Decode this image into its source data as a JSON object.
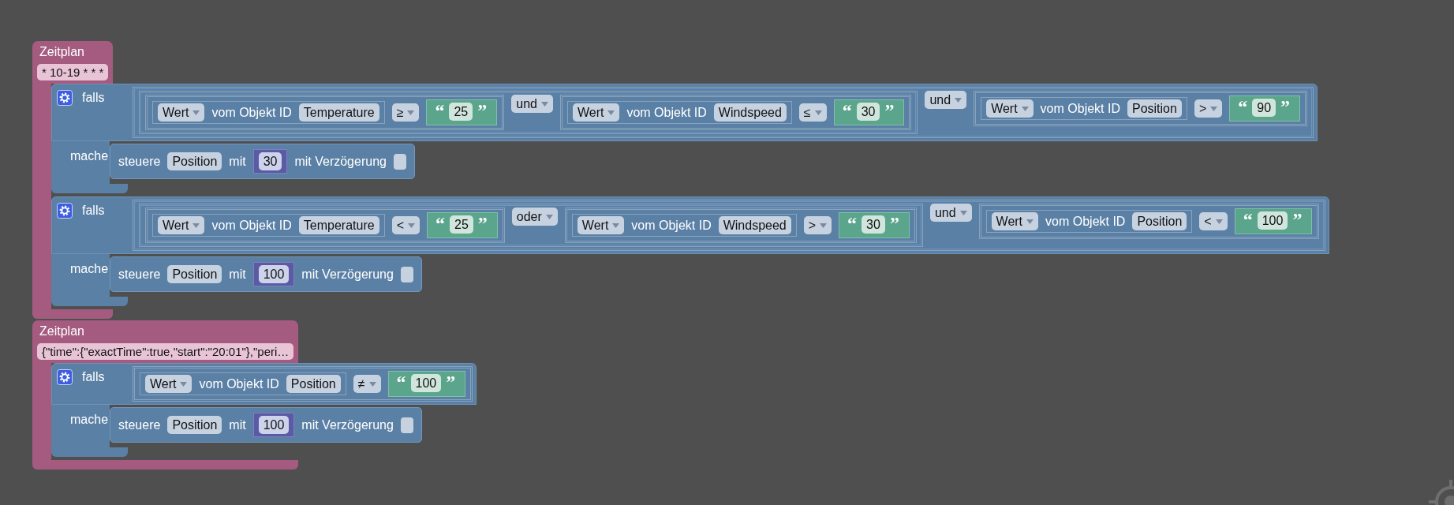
{
  "schedules": [
    {
      "title": "Zeitplan",
      "schedule": "* 10-19 * * *",
      "statements": [
        {
          "kind": "if",
          "if_label": "falls",
          "do_label": "mache",
          "condition": {
            "kind": "logic",
            "operator": "und",
            "left": {
              "kind": "logic",
              "operator": "und",
              "left": {
                "kind": "compare",
                "operator": "≥",
                "left": {
                  "kind": "get",
                  "mode": "Wert",
                  "label": "vom Objekt ID",
                  "object": "Temperature"
                },
                "right": {
                  "kind": "text",
                  "open_quote": "“",
                  "value": "25",
                  "close_quote": "”"
                }
              },
              "right": {
                "kind": "compare",
                "operator": "≤",
                "left": {
                  "kind": "get",
                  "mode": "Wert",
                  "label": "vom Objekt ID",
                  "object": "Windspeed"
                },
                "right": {
                  "kind": "text",
                  "open_quote": "“",
                  "value": "30",
                  "close_quote": "”"
                }
              }
            },
            "right": {
              "kind": "compare",
              "operator": ">",
              "left": {
                "kind": "get",
                "mode": "Wert",
                "label": "vom Objekt ID",
                "object": "Position"
              },
              "right": {
                "kind": "text",
                "open_quote": "“",
                "value": "90",
                "close_quote": "”"
              }
            }
          },
          "action": {
            "kind": "control",
            "verb": "steuere",
            "object": "Position",
            "with_label": "mit",
            "value": "30",
            "delay_label": "mit Verzögerung",
            "delay": false
          }
        },
        {
          "kind": "if",
          "if_label": "falls",
          "do_label": "mache",
          "condition": {
            "kind": "logic",
            "operator": "und",
            "left": {
              "kind": "logic",
              "operator": "oder",
              "left": {
                "kind": "compare",
                "operator": "<",
                "left": {
                  "kind": "get",
                  "mode": "Wert",
                  "label": "vom Objekt ID",
                  "object": "Temperature"
                },
                "right": {
                  "kind": "text",
                  "open_quote": "“",
                  "value": "25",
                  "close_quote": "”"
                }
              },
              "right": {
                "kind": "compare",
                "operator": ">",
                "left": {
                  "kind": "get",
                  "mode": "Wert",
                  "label": "vom Objekt ID",
                  "object": "Windspeed"
                },
                "right": {
                  "kind": "text",
                  "open_quote": "“",
                  "value": "30",
                  "close_quote": "”"
                }
              }
            },
            "right": {
              "kind": "compare",
              "operator": "<",
              "left": {
                "kind": "get",
                "mode": "Wert",
                "label": "vom Objekt ID",
                "object": "Position"
              },
              "right": {
                "kind": "text",
                "open_quote": "“",
                "value": "100",
                "close_quote": "”"
              }
            }
          },
          "action": {
            "kind": "control",
            "verb": "steuere",
            "object": "Position",
            "with_label": "mit",
            "value": "100",
            "delay_label": "mit Verzögerung",
            "delay": false
          }
        }
      ]
    },
    {
      "title": "Zeitplan",
      "schedule": "{\"time\":{\"exactTime\":true,\"start\":\"20:01\"},\"peri…",
      "statements": [
        {
          "kind": "if",
          "if_label": "falls",
          "do_label": "mache",
          "condition": {
            "kind": "compare",
            "operator": "≠",
            "left": {
              "kind": "get",
              "mode": "Wert",
              "label": "vom Objekt ID",
              "object": "Position"
            },
            "right": {
              "kind": "text",
              "open_quote": "“",
              "value": "100",
              "close_quote": "”"
            }
          },
          "action": {
            "kind": "control",
            "verb": "steuere",
            "object": "Position",
            "with_label": "mit",
            "value": "100",
            "delay_label": "mit Verzögerung",
            "delay": false
          }
        }
      ]
    }
  ]
}
